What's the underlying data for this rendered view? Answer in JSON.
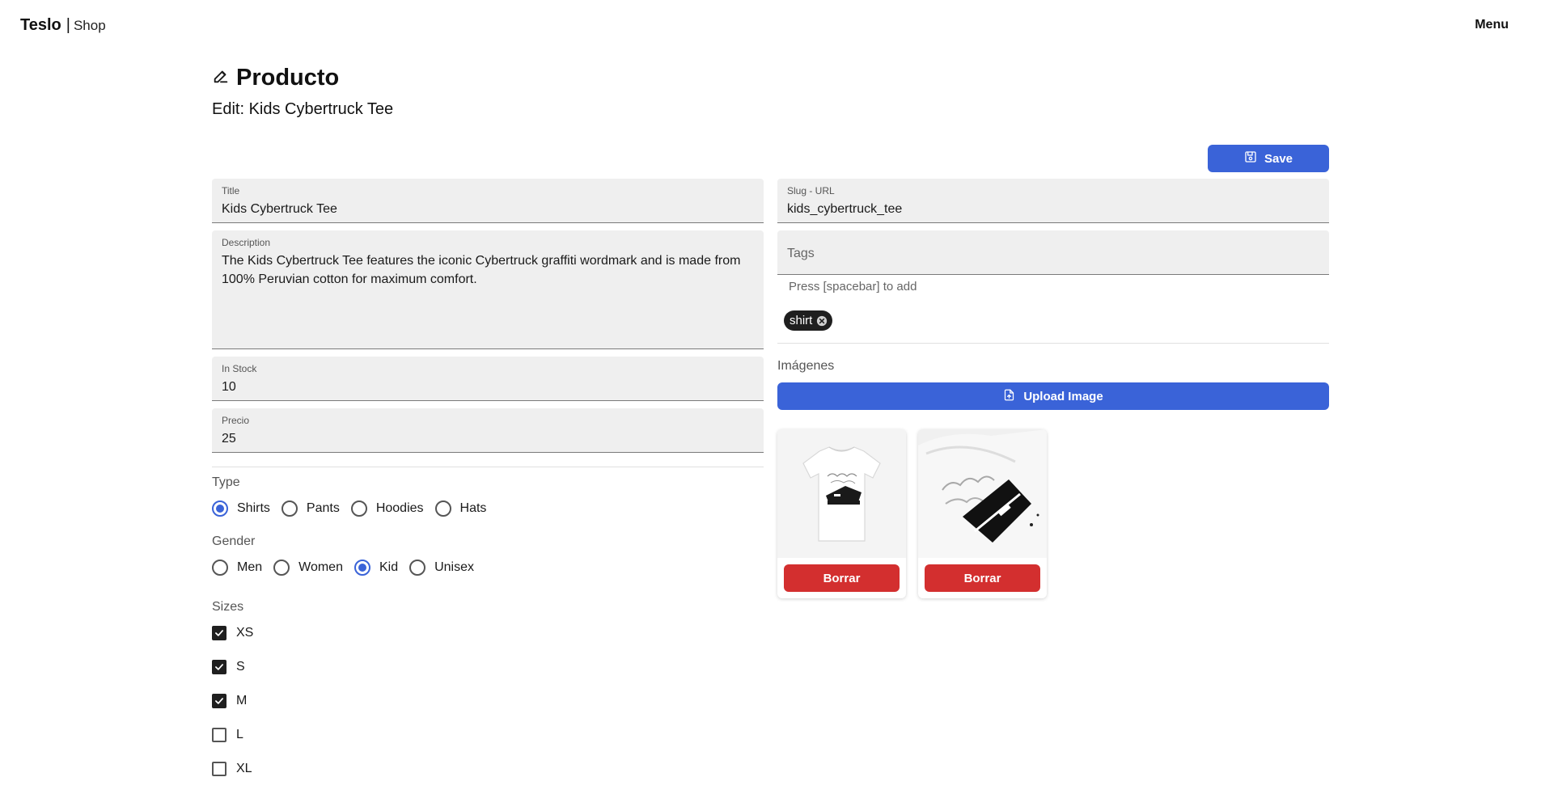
{
  "navbar": {
    "brand_name": "Teslo",
    "brand_sep": "|",
    "brand_shop": "Shop",
    "menu_label": "Menu"
  },
  "header": {
    "title": "Producto",
    "subtitle": "Edit: Kids Cybertruck Tee",
    "title_icon": "edit-pen-icon"
  },
  "actions": {
    "save_label": "Save",
    "save_icon": "save-icon"
  },
  "form": {
    "title": {
      "label": "Title",
      "value": "Kids Cybertruck Tee"
    },
    "description": {
      "label": "Description",
      "value": "The Kids Cybertruck Tee features the iconic Cybertruck graffiti wordmark and is made from 100% Peruvian cotton for maximum comfort."
    },
    "in_stock": {
      "label": "In Stock",
      "value": "10"
    },
    "price": {
      "label": "Precio",
      "value": "25"
    },
    "slug": {
      "label": "Slug - URL",
      "value": "kids_cybertruck_tee"
    },
    "tags": {
      "placeholder": "Tags",
      "help": "Press [spacebar] to add",
      "items": [
        "shirt"
      ]
    },
    "type": {
      "label": "Type",
      "options": [
        "Shirts",
        "Pants",
        "Hoodies",
        "Hats"
      ],
      "selected": "Shirts"
    },
    "gender": {
      "label": "Gender",
      "options": [
        "Men",
        "Women",
        "Kid",
        "Unisex"
      ],
      "selected": "Kid"
    },
    "sizes": {
      "label": "Sizes",
      "options": [
        {
          "label": "XS",
          "checked": true
        },
        {
          "label": "S",
          "checked": true
        },
        {
          "label": "M",
          "checked": true
        },
        {
          "label": "L",
          "checked": false
        },
        {
          "label": "XL",
          "checked": false
        }
      ]
    }
  },
  "images": {
    "label": "Imágenes",
    "upload_label": "Upload Image",
    "upload_icon": "upload-file-icon",
    "items": [
      {
        "alt": "kids-cybertruck-tee-front",
        "delete_label": "Borrar"
      },
      {
        "alt": "kids-cybertruck-tee-closeup",
        "delete_label": "Borrar"
      }
    ]
  },
  "colors": {
    "primary": "#3a63d8",
    "danger": "#d32f2f",
    "field_bg": "#efefef",
    "chip_bg": "#1f1f1f"
  }
}
